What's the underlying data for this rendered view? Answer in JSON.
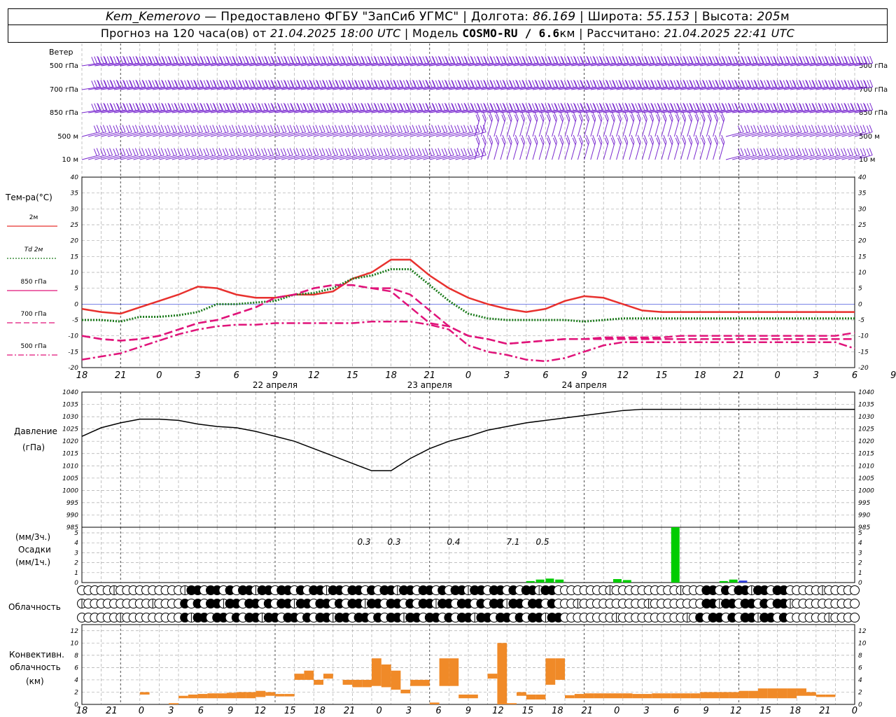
{
  "header": {
    "station": "Kem_Kemerovo",
    "dash": " — ",
    "provider": "Предоставлено ФГБУ \"ЗапСиб УГМС\"",
    "lon_label": "Долгота:",
    "lon": "86.169",
    "lat_label": "Широта:",
    "lat": "55.153",
    "alt_label": "Высота:",
    "alt": "205",
    "alt_unit": "м",
    "forecast_label": "Прогноз на 120 часа(ов) от",
    "forecast_start": "21.04.2025 18:00 UTC",
    "model_label": "Модель",
    "model": "COSMO-RU / 6.6",
    "model_unit": "км",
    "computed_label": "Рассчитано:",
    "computed": "21.04.2025 22:41 UTC"
  },
  "wind_panel": {
    "title": "Ветер",
    "levels": [
      "500 гПа",
      "700 гПа",
      "850 гПа",
      "500 м",
      "10  м"
    ]
  },
  "temp_panel": {
    "title": "Тем-ра(°C)",
    "legend": [
      {
        "label": "2м",
        "color": "#e8312e",
        "style": "solid"
      },
      {
        "label": "Td  2м",
        "color": "#1a7a1a",
        "style": "dotted"
      },
      {
        "label": "850 гПа",
        "color": "#e0147a",
        "style": "solid"
      },
      {
        "label": "700 гПа",
        "color": "#e0147a",
        "style": "dashed"
      },
      {
        "label": "500 гПа",
        "color": "#e0147a",
        "style": "dashdot"
      }
    ],
    "day_labels": [
      "22 апреля",
      "23 апреля",
      "24 апреля"
    ]
  },
  "pressure_panel": {
    "title": "Давление",
    "unit": "(гПа)"
  },
  "precip_panel": {
    "unit_top": "(мм/3ч.)",
    "title": "Осадки",
    "unit_bottom": "(мм/1ч.)",
    "labels": [
      "0.3",
      "0.3",
      "0.4",
      "7.1",
      "0.5"
    ]
  },
  "cloud_panel": {
    "title": "Облачность"
  },
  "conv_panel": {
    "title_1": "Конвективн.",
    "title_2": "облачность",
    "unit": "(км)"
  },
  "colors": {
    "wind": "#7a2ad0",
    "precip": "#00cc00",
    "precip_blue": "#2a3ad8",
    "conv": "#f08a28",
    "grid": "#aaaaaa"
  },
  "chart_data": [
    {
      "type": "line",
      "name": "temperature",
      "x_hours": [
        0,
        3,
        6,
        9,
        12,
        15,
        18,
        21,
        24,
        27,
        30,
        33,
        36,
        39,
        42,
        45,
        48,
        51,
        54,
        57,
        60,
        63,
        66,
        69,
        72,
        75,
        78,
        81,
        84,
        87,
        90,
        93,
        96,
        99,
        102,
        105,
        108,
        111,
        114,
        117,
        120
      ],
      "xticks": [
        "18",
        "21",
        "0",
        "3",
        "6",
        "9",
        "12",
        "15",
        "18",
        "21",
        "0",
        "3",
        "6",
        "9",
        "12",
        "15",
        "18",
        "21",
        "0",
        "3",
        "6",
        "9",
        "12",
        "15",
        "18",
        "21",
        "0"
      ],
      "ylim": [
        -20,
        40
      ],
      "yticks": [
        -20,
        -15,
        -10,
        -5,
        0,
        5,
        10,
        15,
        20,
        25,
        30,
        35,
        40
      ],
      "series": [
        {
          "name": "2м",
          "values": [
            -1.5,
            -2.5,
            -3,
            -1,
            1,
            3,
            5.5,
            5,
            3,
            2,
            2,
            3,
            3,
            4,
            8,
            10,
            14,
            14,
            9,
            5,
            2,
            0,
            -1.5,
            -2.5,
            -1.5,
            1,
            2.5,
            2,
            0,
            -2,
            -2.5,
            -2.5,
            -2.5,
            -2.5,
            -2.5,
            -2.5,
            -2.5,
            -2.5,
            -2.5,
            -2.5,
            -2.5
          ]
        },
        {
          "name": "Td  2м",
          "values": [
            -5,
            -5,
            -5.5,
            -4,
            -4,
            -3.5,
            -2.5,
            0,
            0,
            0.5,
            1,
            3,
            3.5,
            5,
            8,
            9,
            11,
            11,
            6,
            1,
            -3,
            -4.5,
            -5,
            -5,
            -5,
            -5,
            -5.5,
            -5,
            -4.5,
            -4.5,
            -4.5,
            -4.5,
            -4.5,
            -4.5,
            -4.5,
            -4.5,
            -4.5,
            -4.5,
            -4.5,
            -4.5,
            -4.5
          ]
        },
        {
          "name": "850 гПа",
          "values": [
            -10,
            -11,
            -11.5,
            -11,
            -10,
            -8,
            -6,
            -5,
            -3,
            -1,
            2,
            3,
            5,
            6,
            6,
            5,
            5,
            3,
            -2,
            -7,
            -10,
            -11,
            -12.5,
            -12,
            -11.5,
            -11,
            -11,
            -10.5,
            -10.5,
            -10.5,
            -10.5,
            -10,
            -10,
            -10,
            -10,
            -10,
            -10,
            -10,
            -10,
            -10,
            -9
          ]
        },
        {
          "name": "700 гПа",
          "values": [
            -10,
            -11,
            -11.5,
            -11,
            -10,
            -8,
            -6,
            -5,
            -3,
            -1,
            2,
            3,
            5,
            6,
            6,
            5,
            4,
            -1,
            -6,
            -7,
            -10,
            -11,
            -12.5,
            -12,
            -11.5,
            -11,
            -11,
            -11,
            -11,
            -11,
            -11,
            -11,
            -11,
            -11,
            -11,
            -11,
            -11,
            -11,
            -11,
            -11,
            -11
          ]
        },
        {
          "name": "500 гПа",
          "values": [
            -17.5,
            -16.5,
            -15.5,
            -13.5,
            -11.5,
            -9.5,
            -8,
            -7,
            -6.5,
            -6.5,
            -6,
            -6,
            -6,
            -6,
            -6,
            -5.5,
            -5.5,
            -5.5,
            -6.5,
            -8,
            -13,
            -15,
            -16,
            -17.5,
            -18,
            -17,
            -15,
            -13,
            -12,
            -12,
            -12,
            -12,
            -12,
            -12,
            -12,
            -12,
            -12,
            -12,
            -12,
            -12,
            -14
          ]
        }
      ]
    },
    {
      "type": "line",
      "name": "pressure",
      "ylim": [
        985,
        1040
      ],
      "yticks": [
        985,
        990,
        995,
        1000,
        1005,
        1010,
        1015,
        1020,
        1025,
        1030,
        1035,
        1040
      ],
      "series": [
        {
          "name": "Давление",
          "values": [
            1022,
            1025.5,
            1027.5,
            1029,
            1029,
            1028.5,
            1027,
            1026,
            1025.5,
            1024,
            1022,
            1020,
            1017,
            1014,
            1011,
            1008,
            1008,
            1013,
            1017,
            1020,
            1022,
            1024.5,
            1026,
            1027.5,
            1028.5,
            1029.5,
            1030.5,
            1031.5,
            1032.5,
            1033,
            1033,
            1033,
            1033,
            1033,
            1033,
            1033,
            1033,
            1033,
            1033,
            1033,
            1033
          ]
        }
      ]
    },
    {
      "type": "bar",
      "name": "precipitation",
      "ylim": [
        0,
        5
      ],
      "yticks": [
        0,
        1,
        2,
        3,
        4,
        5
      ],
      "bars": [
        {
          "hour": 46,
          "value": 0.15,
          "color": "#00cc00"
        },
        {
          "hour": 47,
          "value": 0.3,
          "color": "#00cc00"
        },
        {
          "hour": 48,
          "value": 0.4,
          "color": "#00cc00"
        },
        {
          "hour": 49,
          "value": 0.3,
          "color": "#00cc00"
        },
        {
          "hour": 55,
          "value": 0.35,
          "color": "#00cc00"
        },
        {
          "hour": 56,
          "value": 0.25,
          "color": "#00cc00"
        },
        {
          "hour": 61,
          "value": 5.5,
          "color": "#00cc00"
        },
        {
          "hour": 66,
          "value": 0.15,
          "color": "#00cc00"
        },
        {
          "hour": 67,
          "value": 0.3,
          "color": "#00cc00"
        },
        {
          "hour": 68,
          "value": 0.2,
          "color": "#2a3ad8"
        }
      ]
    },
    {
      "type": "bar",
      "name": "convective cloud",
      "ylim": [
        0,
        13
      ],
      "yticks": [
        0,
        2,
        4,
        6,
        8,
        10,
        12
      ],
      "bars": [
        {
          "hour": 6,
          "top": 2,
          "base": 1.6
        },
        {
          "hour": 9,
          "top": 0.2,
          "base": 0
        },
        {
          "hour": 10,
          "top": 1.4,
          "base": 1
        },
        {
          "hour": 11,
          "top": 1.6,
          "base": 1
        },
        {
          "hour": 12,
          "top": 1.7,
          "base": 1
        },
        {
          "hour": 13,
          "top": 1.8,
          "base": 1
        },
        {
          "hour": 14,
          "top": 1.8,
          "base": 1
        },
        {
          "hour": 15,
          "top": 1.9,
          "base": 1
        },
        {
          "hour": 16,
          "top": 2,
          "base": 1
        },
        {
          "hour": 17,
          "top": 2,
          "base": 1
        },
        {
          "hour": 18,
          "top": 2.2,
          "base": 1.2
        },
        {
          "hour": 19,
          "top": 2,
          "base": 1.4
        },
        {
          "hour": 20,
          "top": 1.7,
          "base": 1.3
        },
        {
          "hour": 21,
          "top": 1.7,
          "base": 1.3
        },
        {
          "hour": 22,
          "top": 5,
          "base": 4
        },
        {
          "hour": 23,
          "top": 5.5,
          "base": 4
        },
        {
          "hour": 24,
          "top": 4,
          "base": 3.2
        },
        {
          "hour": 25,
          "top": 5,
          "base": 4.2
        },
        {
          "hour": 27,
          "top": 4,
          "base": 3.2
        },
        {
          "hour": 28,
          "top": 4,
          "base": 2.8
        },
        {
          "hour": 29,
          "top": 4,
          "base": 2.8
        },
        {
          "hour": 30,
          "top": 7.5,
          "base": 3
        },
        {
          "hour": 31,
          "top": 6.5,
          "base": 2.8
        },
        {
          "hour": 32,
          "top": 5.5,
          "base": 2.4
        },
        {
          "hour": 33,
          "top": 2.4,
          "base": 1.8
        },
        {
          "hour": 34,
          "top": 4,
          "base": 3
        },
        {
          "hour": 35,
          "top": 4,
          "base": 3
        },
        {
          "hour": 36,
          "top": 0.3,
          "base": 0
        },
        {
          "hour": 37,
          "top": 7.5,
          "base": 3
        },
        {
          "hour": 38,
          "top": 7.5,
          "base": 3
        },
        {
          "hour": 39,
          "top": 1.6,
          "base": 1
        },
        {
          "hour": 40,
          "top": 1.6,
          "base": 1
        },
        {
          "hour": 42,
          "top": 5,
          "base": 4.2
        },
        {
          "hour": 43,
          "top": 10,
          "base": 0
        },
        {
          "hour": 44,
          "top": 0.2,
          "base": 0
        },
        {
          "hour": 45,
          "top": 2,
          "base": 1.4
        },
        {
          "hour": 46,
          "top": 1.6,
          "base": 0.8
        },
        {
          "hour": 47,
          "top": 1.6,
          "base": 0.8
        },
        {
          "hour": 48,
          "top": 7.5,
          "base": 3.2
        },
        {
          "hour": 49,
          "top": 7.5,
          "base": 4
        },
        {
          "hour": 50,
          "top": 1.5,
          "base": 1
        },
        {
          "hour": 51,
          "top": 1.7,
          "base": 1
        },
        {
          "hour": 52,
          "top": 1.8,
          "base": 1
        },
        {
          "hour": 53,
          "top": 1.8,
          "base": 1
        },
        {
          "hour": 54,
          "top": 1.8,
          "base": 1
        },
        {
          "hour": 55,
          "top": 1.8,
          "base": 1
        },
        {
          "hour": 56,
          "top": 1.8,
          "base": 1
        },
        {
          "hour": 57,
          "top": 1.7,
          "base": 1
        },
        {
          "hour": 58,
          "top": 1.7,
          "base": 1
        },
        {
          "hour": 59,
          "top": 1.8,
          "base": 1
        },
        {
          "hour": 60,
          "top": 1.8,
          "base": 1
        },
        {
          "hour": 61,
          "top": 1.8,
          "base": 1
        },
        {
          "hour": 62,
          "top": 1.8,
          "base": 1
        },
        {
          "hour": 63,
          "top": 1.8,
          "base": 1
        },
        {
          "hour": 64,
          "top": 2,
          "base": 1
        },
        {
          "hour": 65,
          "top": 2,
          "base": 1
        },
        {
          "hour": 66,
          "top": 2,
          "base": 1
        },
        {
          "hour": 67,
          "top": 2,
          "base": 1
        },
        {
          "hour": 68,
          "top": 2.2,
          "base": 1
        },
        {
          "hour": 69,
          "top": 2.2,
          "base": 1
        },
        {
          "hour": 70,
          "top": 2.6,
          "base": 1
        },
        {
          "hour": 71,
          "top": 2.6,
          "base": 1
        },
        {
          "hour": 72,
          "top": 2.6,
          "base": 1
        },
        {
          "hour": 73,
          "top": 2.6,
          "base": 1
        },
        {
          "hour": 74,
          "top": 2.6,
          "base": 1.4
        },
        {
          "hour": 75,
          "top": 2,
          "base": 1.4
        },
        {
          "hour": 76,
          "top": 1.6,
          "base": 1.2
        },
        {
          "hour": 77,
          "top": 1.6,
          "base": 1.2
        }
      ]
    }
  ]
}
